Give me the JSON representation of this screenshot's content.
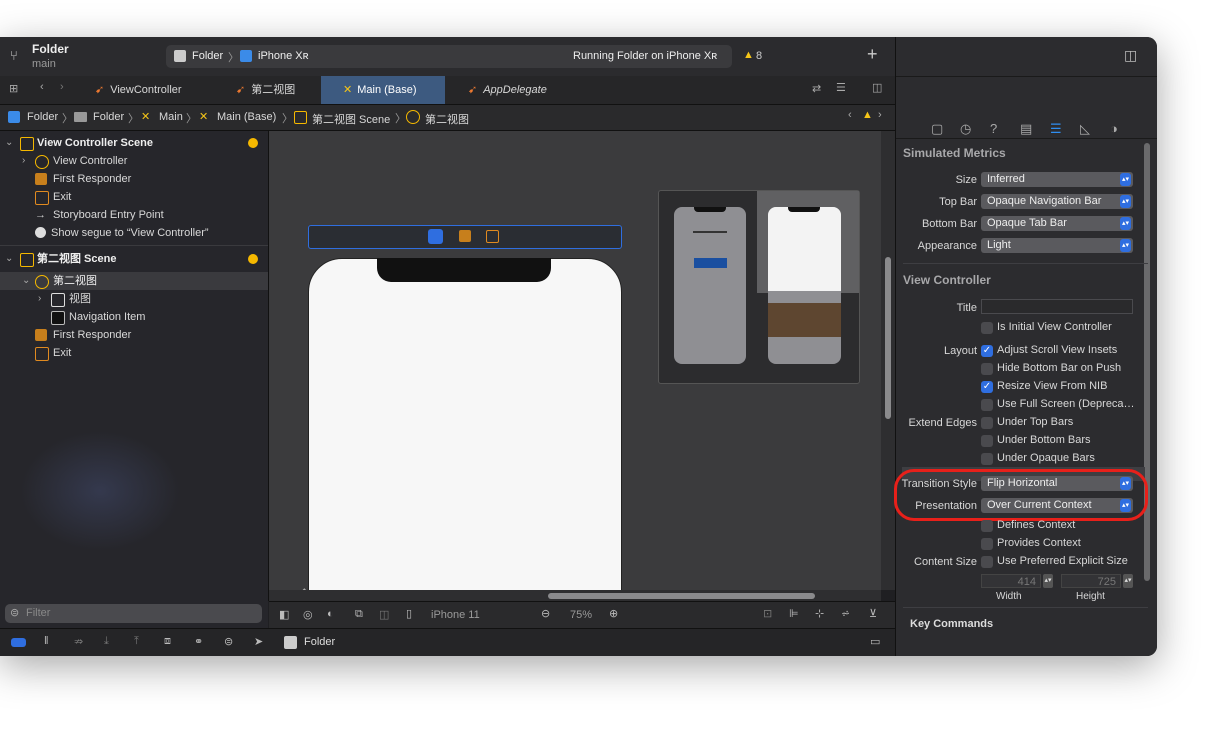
{
  "toolbar": {
    "project_name": "Folder",
    "branch": "main",
    "scheme": "Folder",
    "device": "iPhone Xʀ",
    "status": "Running Folder on iPhone Xʀ",
    "warning_count": "8",
    "add_label": "+"
  },
  "tabs": [
    {
      "label": "ViewController"
    },
    {
      "label": "第二视图"
    },
    {
      "label": "Main (Base)"
    },
    {
      "label": "AppDelegate"
    }
  ],
  "jumpbar": {
    "items": [
      "Folder",
      "Folder",
      "Main",
      "Main (Base)",
      "第二视图 Scene",
      "第二视图"
    ]
  },
  "navigator": {
    "scene1": {
      "title": "View Controller Scene",
      "items": [
        "View Controller",
        "First Responder",
        "Exit",
        "Storyboard Entry Point",
        "Show segue to “View Controller”"
      ]
    },
    "scene2": {
      "title": "第二视图 Scene",
      "controller": "第二视图",
      "view": "视图",
      "items": [
        "Navigation Item",
        "First Responder",
        "Exit"
      ]
    },
    "filter_placeholder": "Filter"
  },
  "canvas": {
    "device_label": "iPhone 11",
    "zoom": "75%"
  },
  "debugbar": {
    "target": "Folder"
  },
  "inspector": {
    "simulated_metrics": {
      "heading": "Simulated Metrics",
      "size_label": "Size",
      "size_value": "Inferred",
      "topbar_label": "Top Bar",
      "topbar_value": "Opaque Navigation Bar",
      "bottombar_label": "Bottom Bar",
      "bottombar_value": "Opaque Tab Bar",
      "appearance_label": "Appearance",
      "appearance_value": "Light"
    },
    "view_controller": {
      "heading": "View Controller",
      "title_label": "Title",
      "title_value": "",
      "initial_label": "Is Initial View Controller",
      "layout_label": "Layout",
      "layout_options": [
        {
          "label": "Adjust Scroll View Insets",
          "checked": true
        },
        {
          "label": "Hide Bottom Bar on Push",
          "checked": false
        },
        {
          "label": "Resize View From NIB",
          "checked": true
        },
        {
          "label": "Use Full Screen (Depreca…",
          "checked": false
        }
      ],
      "extend_label": "Extend Edges",
      "extend_options": [
        {
          "label": "Under Top Bars",
          "checked": false
        },
        {
          "label": "Under Bottom Bars",
          "checked": false
        },
        {
          "label": "Under Opaque Bars",
          "checked": false
        }
      ],
      "transition_label": "Transition Style",
      "transition_value": "Flip Horizontal",
      "presentation_label": "Presentation",
      "presentation_value": "Over Current Context",
      "defines_context": "Defines Context",
      "provides_context": "Provides Context",
      "content_size_label": "Content Size",
      "content_size_option": "Use Preferred Explicit Size",
      "width_value": "414",
      "height_value": "725",
      "width_label": "Width",
      "height_label": "Height"
    },
    "key_commands": "Key Commands"
  },
  "colors": {
    "accent": "#2f6ee0",
    "highlight_ring": "#e8201a",
    "warning": "#f5c518",
    "scene_icon": "#f5b800"
  }
}
